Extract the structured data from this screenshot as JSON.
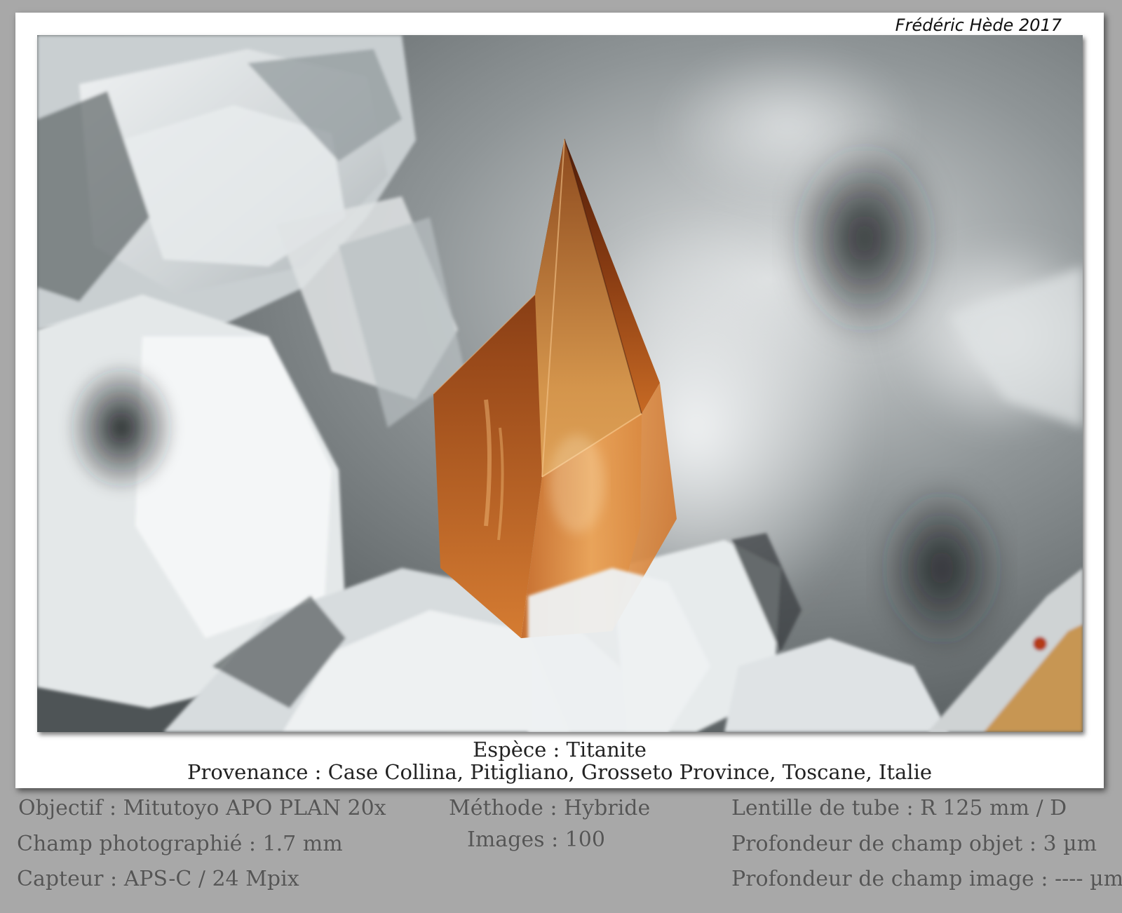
{
  "signature": "Frédéric Hède 2017",
  "caption": {
    "species": "Espèce : Titanite",
    "provenance": "Provenance : Case Collina, Pitigliano, Grosseto Province, Toscane, Italie"
  },
  "tech": {
    "objectif": "Objectif : Mitutoyo APO PLAN 20x",
    "champ": "Champ photographié : 1.7 mm",
    "capteur": "Capteur : APS-C / 24 Mpix",
    "methode": "Méthode : Hybride",
    "images": "Images : 100",
    "lentille": "Lentille de tube : R 125 mm / D",
    "profondeur_objet": "Profondeur de champ objet : 3 µm",
    "profondeur_image": "Profondeur de champ image : ---- µm"
  },
  "colors": {
    "frame_bg": "#a8a8a8",
    "card_bg": "#ffffff",
    "crystal_dark": "#6b2a0e",
    "crystal_light": "#e89a48"
  }
}
